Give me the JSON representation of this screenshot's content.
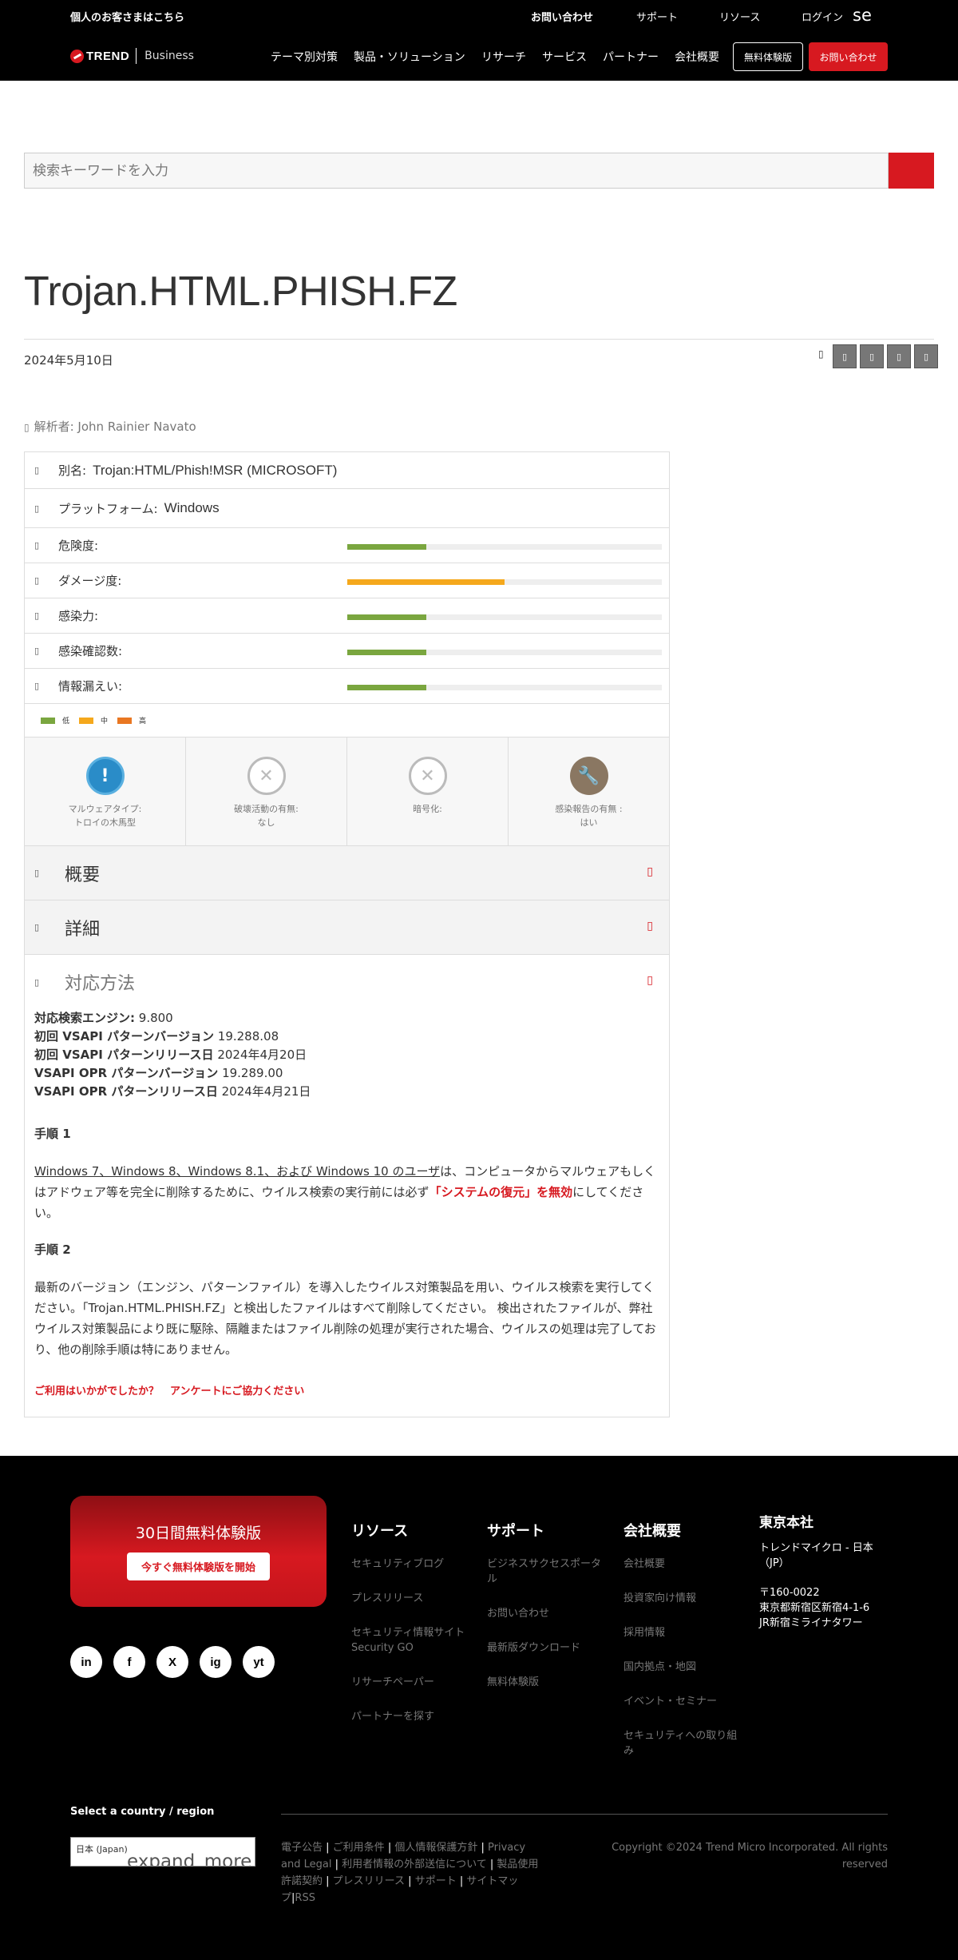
{
  "header": {
    "personal_link": "個人のお客さまはこちら",
    "top_links": {
      "contact": "お問い合わせ",
      "support": "サポート",
      "resources": "リソース",
      "login": "ログイン",
      "lang": "se"
    },
    "logo_brand": "TREND",
    "logo_sub": "Business",
    "nav": [
      "テーマ別対策",
      "製品・ソリューション",
      "リサーチ",
      "サービス",
      "パートナー",
      "会社概要"
    ],
    "trial_button": "無料体験版",
    "contact_button": "お問い合わせ"
  },
  "search": {
    "placeholder": "検索キーワードを入力"
  },
  "article": {
    "title": "Trojan.HTML.PHISH.FZ",
    "date": "2024年5月10日",
    "analyst": "解析者: John Rainier Navato"
  },
  "info": {
    "alias_label": "別名:",
    "alias_value": "Trojan:HTML/Phish!MSR (MICROSOFT)",
    "platform_label": "プラットフォーム:",
    "platform_value": "Windows",
    "meters": [
      {
        "label": "危険度:",
        "level": 0.25,
        "color": "#7aa63f"
      },
      {
        "label": "ダメージ度:",
        "level": 0.5,
        "color": "#f5a81c"
      },
      {
        "label": "感染力:",
        "level": 0.25,
        "color": "#7aa63f"
      },
      {
        "label": "感染確認数:",
        "level": 0.25,
        "color": "#7aa63f"
      },
      {
        "label": "情報漏えい:",
        "level": 0.25,
        "color": "#7aa63f"
      }
    ],
    "legend": [
      {
        "label": "低",
        "color": "#7aa63f"
      },
      {
        "label": "中",
        "color": "#f5a81c"
      },
      {
        "label": "高",
        "color": "#e97722"
      }
    ],
    "features": [
      {
        "line1": "マルウェアタイプ:",
        "line2": "トロイの木馬型",
        "icon": "info-icon"
      },
      {
        "line1": "破壊活動の有無:",
        "line2": "なし",
        "icon": "x-icon"
      },
      {
        "line1": "暗号化:",
        "line2": "",
        "icon": "x-icon"
      },
      {
        "line1": "感染報告の有無 :",
        "line2": "はい",
        "icon": "bug-icon"
      }
    ]
  },
  "accordions": {
    "overview": "概要",
    "details": "詳細",
    "solution": "対応方法"
  },
  "solution": {
    "engine_label": "対応検索エンジン:",
    "engine_value": "9.800",
    "vsapi_first_label": "初回 VSAPI パターンバージョン",
    "vsapi_first_value": "19.288.08",
    "vsapi_first_date_label": "初回 VSAPI パターンリリース日",
    "vsapi_first_date_value": "2024年4月20日",
    "vsapi_opr_label": "VSAPI OPR パターンバージョン",
    "vsapi_opr_value": "19.289.00",
    "vsapi_opr_date_label": "VSAPI OPR パターンリリース日",
    "vsapi_opr_date_value": "2024年4月21日",
    "step1_title": "手順 1",
    "step1_link": "Windows 7、Windows 8、Windows 8.1、および Windows 10 のユーザ",
    "step1_mid": "は、コンピュータからマルウェアもしくはアドウェア等を完全に削除するために、ウイルス検索の実行前には必ず",
    "step1_red": "「システムの復元」を無効",
    "step1_end": "にしてください。",
    "step2_title": "手順 2",
    "step2_text": "最新のバージョン（エンジン、パターンファイル）を導入したウイルス対策製品を用い、ウイルス検索を実行してください。「Trojan.HTML.PHISH.FZ」と検出したファイルはすべて削除してください。 検出されたファイルが、弊社ウイルス対策製品により既に駆除、隔離またはファイル削除の処理が実行された場合、ウイルスの処理は完了しており、他の削除手順は特にありません。",
    "survey_1": "ご利用はいかがでしたか？",
    "survey_2": "アンケートにご協力ください"
  },
  "footer": {
    "promo_title": "30日間無料体験版",
    "promo_button": "今すぐ無料体験版を開始",
    "social": [
      "in",
      "f",
      "X",
      "ig",
      "yt"
    ],
    "col_resources": {
      "title": "リソース",
      "links": [
        "セキュリティブログ",
        "プレスリリース",
        "セキュリティ情報サイト Security GO",
        "リサーチペーパー",
        "パートナーを探す"
      ]
    },
    "col_support": {
      "title": "サポート",
      "links": [
        "ビジネスサクセスポータル",
        "お問い合わせ",
        "最新版ダウンロード",
        "無料体験版"
      ]
    },
    "col_company": {
      "title": "会社概要",
      "links": [
        "会社概要",
        "投資家向け情報",
        "採用情報",
        "国内拠点・地図",
        "イベント・セミナー",
        "セキュリティへの取り組み"
      ]
    },
    "hq": {
      "title": "東京本社",
      "line1": "トレンドマイクロ - 日本（JP）",
      "postal": "〒160-0022",
      "addr1": "東京都新宿区新宿4-1-6",
      "addr2": "JR新宿ミライナタワー"
    },
    "region_title": "Select a country / region",
    "region_value": "日本 (Japan)",
    "region_icon_text": "expand_more",
    "legal_links": [
      "電子公告",
      "ご利用条件",
      "個人情報保護方針",
      "Privacy and Legal",
      "利用者情報の外部送信について",
      "製品使用許諾契約",
      "プレスリリース",
      "サポート",
      "サイトマップ",
      "RSS"
    ],
    "copyright": "Copyright ©2024 Trend Micro Incorporated. All rights reserved"
  }
}
